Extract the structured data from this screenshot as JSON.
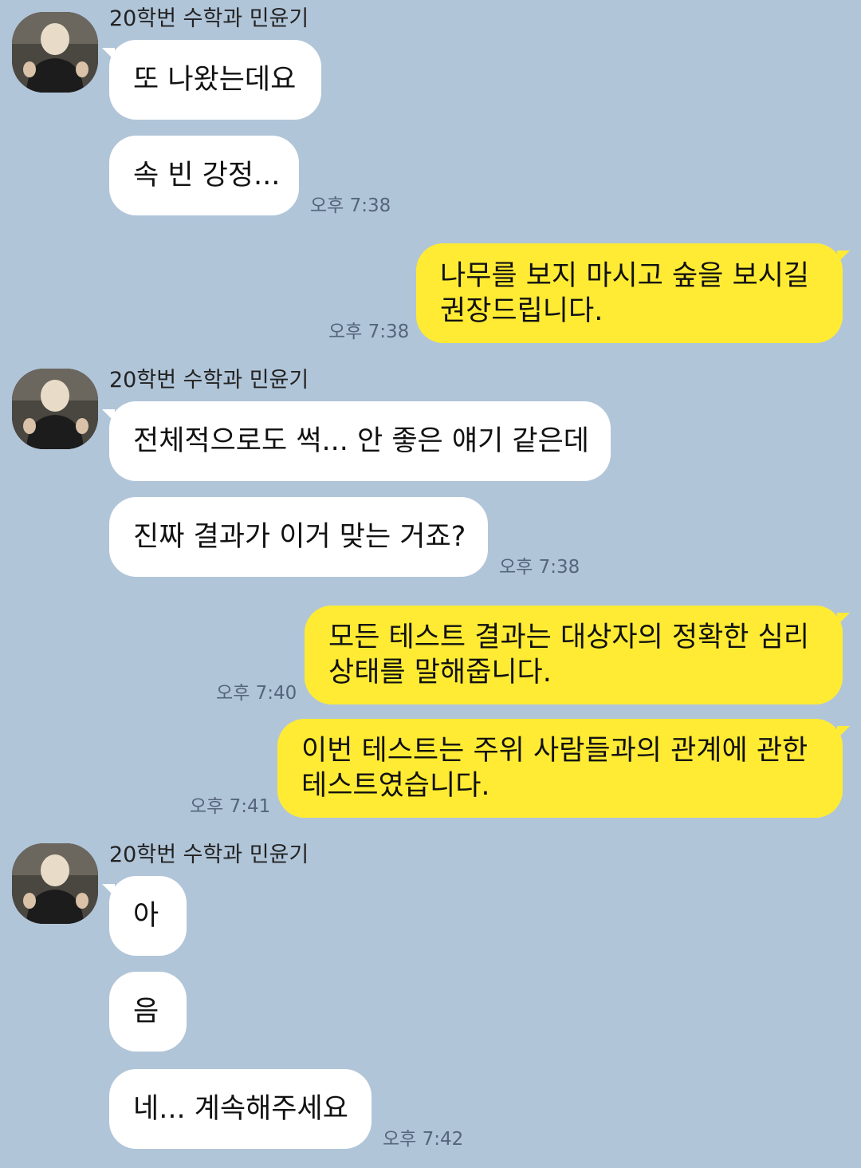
{
  "colors": {
    "background": "#b1c5d9",
    "incoming_bubble": "#ffffff",
    "outgoing_bubble": "#ffeb33",
    "timestamp": "#55657a"
  },
  "groups": [
    {
      "sender": "20학번 수학과 민윤기",
      "avatar_icon": "profile-photo-avatar",
      "messages": [
        "또 나왔는데요",
        "속 빈 강정..."
      ],
      "time": "오후 7:38"
    },
    {
      "outgoing": true,
      "messages": [
        [
          "나무를 보지 마시고 숲을 보시길",
          "권장드립니다."
        ]
      ],
      "time": "오후 7:38"
    },
    {
      "sender": "20학번 수학과 민윤기",
      "avatar_icon": "profile-photo-avatar",
      "messages": [
        "전체적으로도 썩... 안 좋은 얘기 같은데",
        "진짜 결과가 이거 맞는 거죠?"
      ],
      "time": "오후 7:38"
    },
    {
      "outgoing": true,
      "messages": [
        [
          "모든 테스트 결과는 대상자의 정확한 심리",
          "상태를 말해줍니다."
        ]
      ],
      "time": "오후 7:40"
    },
    {
      "outgoing": true,
      "messages": [
        [
          "이번 테스트는 주위 사람들과의 관계에 관한",
          "테스트였습니다."
        ]
      ],
      "time": "오후 7:41"
    },
    {
      "sender": "20학번 수학과 민윤기",
      "avatar_icon": "profile-photo-avatar",
      "messages": [
        "아",
        "음",
        "네... 계속해주세요"
      ],
      "time": "오후 7:42"
    }
  ]
}
